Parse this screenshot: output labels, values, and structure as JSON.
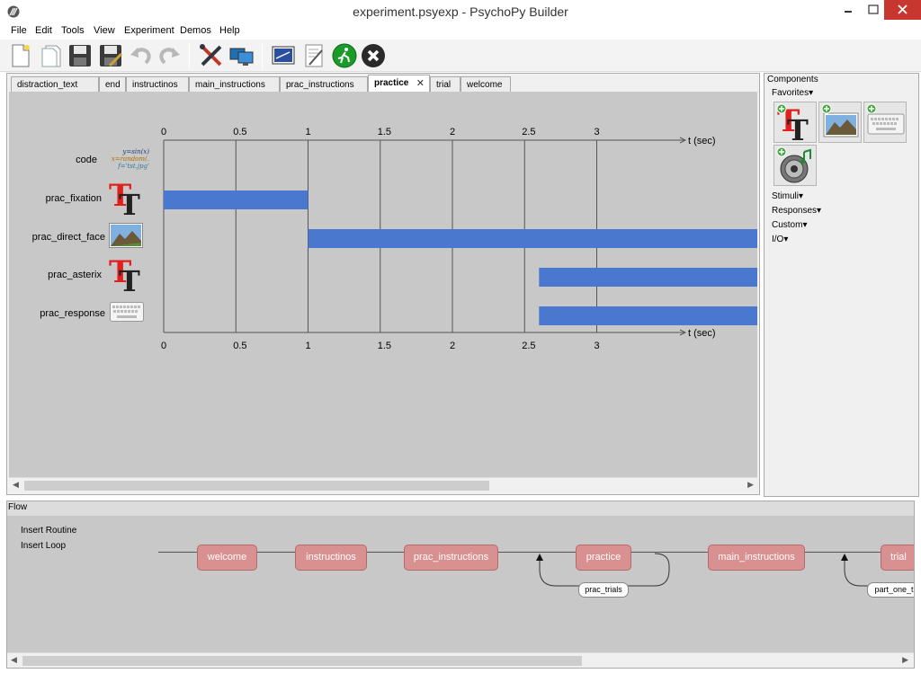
{
  "window": {
    "title": "experiment.psyexp - PsychoPy Builder"
  },
  "menu": [
    "File",
    "Edit",
    "Tools",
    "View",
    "Experiment",
    "Demos",
    "Help"
  ],
  "toolbar": {
    "buttons": [
      {
        "icon": "new-file-icon"
      },
      {
        "icon": "open-file-icon"
      },
      {
        "icon": "save-icon"
      },
      {
        "icon": "save-as-icon"
      },
      {
        "icon": "undo-icon"
      },
      {
        "icon": "redo-icon"
      },
      {
        "icon": "preferences-icon"
      },
      {
        "icon": "monitor-center-icon"
      },
      {
        "icon": "experiment-settings-icon"
      },
      {
        "icon": "compile-script-icon"
      },
      {
        "icon": "run-icon"
      },
      {
        "icon": "stop-icon"
      }
    ]
  },
  "routine_tabs": [
    {
      "label": "distraction_text",
      "active": false
    },
    {
      "label": "end",
      "active": false
    },
    {
      "label": "instructinos",
      "active": false
    },
    {
      "label": "main_instructions",
      "active": false
    },
    {
      "label": "prac_instructions",
      "active": false
    },
    {
      "label": "practice",
      "active": true,
      "close": "✕"
    },
    {
      "label": "trial",
      "active": false
    },
    {
      "label": "welcome",
      "active": false
    }
  ],
  "timeline": {
    "axis_label": "t (sec)",
    "ticks": [
      "0",
      "0.5",
      "1",
      "1.5",
      "2",
      "2.5",
      "3"
    ],
    "tick_values": [
      0,
      0.5,
      1,
      1.5,
      2,
      2.5,
      3
    ],
    "components": [
      {
        "name": "code",
        "icon": "code-icon",
        "snippet": [
          "y=sin(x)",
          "x=random(.",
          "f='tst.jpg'"
        ]
      },
      {
        "name": "prac_fixation",
        "icon": "text-component-icon",
        "start": 0,
        "stop": 1
      },
      {
        "name": "prac_direct_face",
        "icon": "image-component-icon",
        "start": 1,
        "stop": null
      },
      {
        "name": "prac_asterix",
        "icon": "text-component-icon",
        "start": 2.6,
        "stop": null
      },
      {
        "name": "prac_response",
        "icon": "keyboard-component-icon",
        "start": 2.6,
        "stop": null
      }
    ]
  },
  "components_panel": {
    "title": "Components",
    "categories": [
      "Favorites▾",
      "Stimuli▾",
      "Responses▾",
      "Custom▾",
      "I/O▾"
    ],
    "favorites": [
      {
        "icon": "text-component-icon"
      },
      {
        "icon": "image-component-icon"
      },
      {
        "icon": "keyboard-component-icon"
      },
      {
        "icon": "sound-component-icon"
      }
    ]
  },
  "flow": {
    "title": "Flow",
    "insert_routine": "Insert Routine",
    "insert_loop": "Insert Loop",
    "routines": [
      "welcome",
      "instructinos",
      "prac_instructions",
      "practice",
      "main_instructions",
      "trial"
    ],
    "loops": [
      "prac_trials",
      "part_one_t"
    ]
  },
  "colors": {
    "component_bar": "#4a78cf",
    "routine_box": "#d89090",
    "canvas": "#c8c8c8",
    "close_button": "#c7372f"
  }
}
